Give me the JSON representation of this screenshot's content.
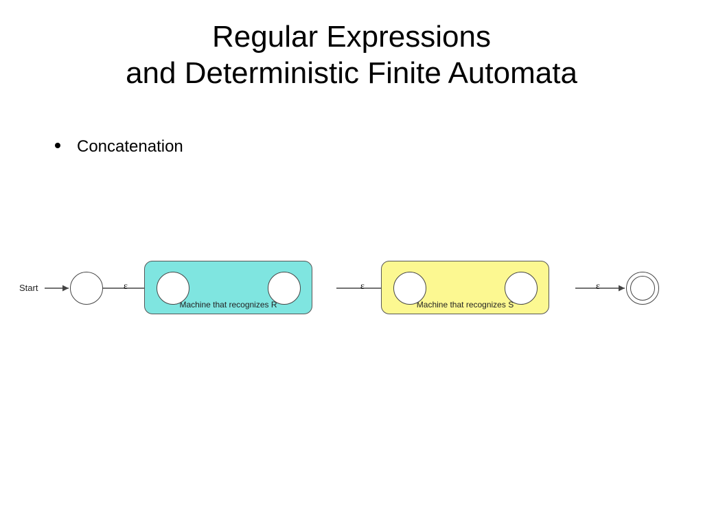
{
  "title_line1": "Regular Expressions",
  "title_line2": "and Deterministic Finite Automata",
  "bullet": "Concatenation",
  "diagram": {
    "start": "Start",
    "eps1": "ε",
    "eps2": "ε",
    "eps3": "ε",
    "box_r": "Machine that recognizes R",
    "box_s": "Machine that recognizes S"
  },
  "chart_data": {
    "type": "diagram",
    "description": "NFA construction for concatenation of two regular expressions R and S",
    "nodes": [
      {
        "id": "start_state",
        "kind": "state"
      },
      {
        "id": "R_in",
        "kind": "state",
        "group": "R"
      },
      {
        "id": "R_out",
        "kind": "state",
        "group": "R"
      },
      {
        "id": "S_in",
        "kind": "state",
        "group": "S"
      },
      {
        "id": "S_out",
        "kind": "state",
        "group": "S"
      },
      {
        "id": "accept",
        "kind": "final"
      }
    ],
    "boxes": [
      {
        "id": "R",
        "label": "Machine that recognizes R",
        "color": "#7fe5e0"
      },
      {
        "id": "S",
        "label": "Machine that recognizes S",
        "color": "#fcf891"
      }
    ],
    "edges": [
      {
        "from": "Start",
        "to": "start_state",
        "label": ""
      },
      {
        "from": "start_state",
        "to": "R_in",
        "label": "ε"
      },
      {
        "from": "R_out",
        "to": "S_in",
        "label": "ε"
      },
      {
        "from": "S_out",
        "to": "accept",
        "label": "ε"
      }
    ]
  }
}
